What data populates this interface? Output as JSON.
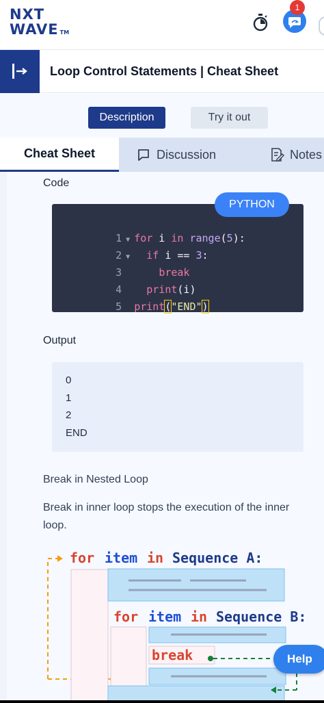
{
  "header": {
    "logo_line1": "NXT",
    "logo_line2": "WAVE",
    "logo_tm": "TM",
    "notification_count": "1",
    "icons": [
      "stopwatch-icon",
      "chat-icon"
    ]
  },
  "titlebar": {
    "title": "Loop Control Statements | Cheat Sheet"
  },
  "mode_buttons": {
    "description": "Description",
    "try_it_out": "Try it out"
  },
  "tabs": {
    "cheat_sheet": "Cheat Sheet",
    "discussion": "Discussion",
    "notes": "Notes"
  },
  "code_section": {
    "label": "Code",
    "language": "PYTHON",
    "line_numbers": [
      "1",
      "2",
      "3",
      "4",
      "5"
    ],
    "lines": [
      [
        "for",
        " i ",
        "in",
        " ",
        "range",
        "(",
        "5",
        "):"
      ],
      [
        "if",
        " i == ",
        "3",
        ":"
      ],
      [
        "break"
      ],
      [
        "print",
        "(i)"
      ],
      [
        "print",
        "(",
        "\"END\"",
        ")"
      ]
    ]
  },
  "output_section": {
    "label": "Output",
    "lines": [
      "0",
      "1",
      "2",
      "END"
    ]
  },
  "nested": {
    "heading": "Break in Nested Loop",
    "text": "Break in inner loop stops the execution of the inner loop.",
    "diagram": {
      "outer_for": [
        "for",
        "item",
        "in",
        "Sequence A:"
      ],
      "inner_for": [
        "for",
        "item",
        "in",
        "Sequence B:"
      ],
      "break": "break"
    }
  },
  "help": {
    "label": "Help"
  },
  "colors": {
    "brand_navy": "#1e3a8a",
    "accent_blue": "#3b82f6",
    "code_bg": "#2d3346",
    "keyword": "#e879a7",
    "diagram_keyword": "#d9452f",
    "diagram_var": "#1d4ed8",
    "arrow_orange": "#f59e0b",
    "arrow_green": "#15803d"
  }
}
